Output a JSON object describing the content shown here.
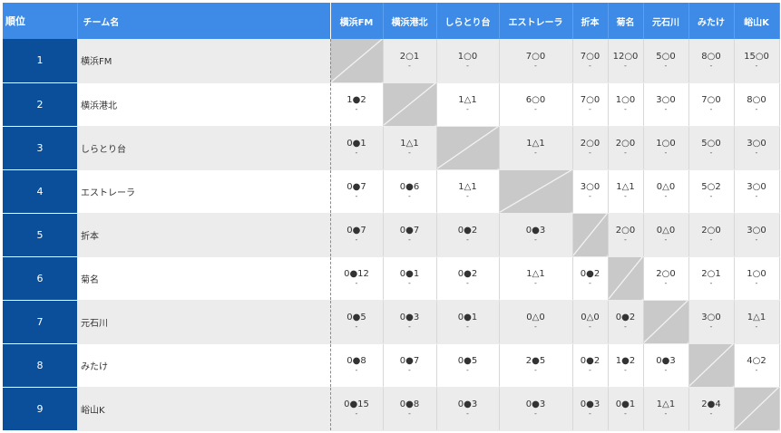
{
  "header": {
    "rank_label": "順位",
    "name_label": "チーム名"
  },
  "teams": [
    "横浜FM",
    "横浜港北",
    "しらとり台",
    "エストレーラ",
    "折本",
    "菊名",
    "元石川",
    "みたけ",
    "峪山K"
  ],
  "rows": [
    {
      "rank": "1",
      "name": "横浜FM",
      "results": [
        null,
        "2○1",
        "1○0",
        "7○0",
        "7○0",
        "12○0",
        "5○0",
        "8○0",
        "15○0"
      ]
    },
    {
      "rank": "2",
      "name": "横浜港北",
      "results": [
        "1●2",
        null,
        "1△1",
        "6○0",
        "7○0",
        "1○0",
        "3○0",
        "7○0",
        "8○0"
      ]
    },
    {
      "rank": "3",
      "name": "しらとり台",
      "results": [
        "0●1",
        "1△1",
        null,
        "1△1",
        "2○0",
        "2○0",
        "1○0",
        "5○0",
        "3○0"
      ]
    },
    {
      "rank": "4",
      "name": "エストレーラ",
      "results": [
        "0●7",
        "0●6",
        "1△1",
        null,
        "3○0",
        "1△1",
        "0△0",
        "5○2",
        "3○0"
      ]
    },
    {
      "rank": "5",
      "name": "折本",
      "results": [
        "0●7",
        "0●7",
        "0●2",
        "0●3",
        null,
        "2○0",
        "0△0",
        "2○0",
        "3○0"
      ]
    },
    {
      "rank": "6",
      "name": "菊名",
      "results": [
        "0●12",
        "0●1",
        "0●2",
        "1△1",
        "0●2",
        null,
        "2○0",
        "2○1",
        "1○0"
      ]
    },
    {
      "rank": "7",
      "name": "元石川",
      "results": [
        "0●5",
        "0●3",
        "0●1",
        "0△0",
        "0△0",
        "0●2",
        null,
        "3○0",
        "1△1"
      ]
    },
    {
      "rank": "8",
      "name": "みたけ",
      "results": [
        "0●8",
        "0●7",
        "0●5",
        "2●5",
        "0●2",
        "1●2",
        "0●3",
        null,
        "4○2"
      ]
    },
    {
      "rank": "9",
      "name": "峪山K",
      "results": [
        "0●15",
        "0●8",
        "0●3",
        "0●3",
        "0●3",
        "0●1",
        "1△1",
        "2●4",
        null
      ]
    }
  ],
  "sub_text": "-"
}
